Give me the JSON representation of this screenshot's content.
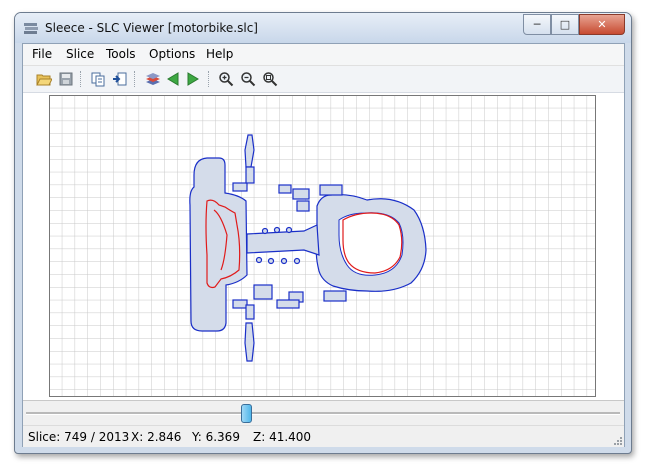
{
  "window": {
    "title": "Sleece - SLC Viewer [motorbike.slc]"
  },
  "caption_buttons": {
    "minimize": "─",
    "maximize": "□",
    "close": "✕"
  },
  "menu": [
    "File",
    "Slice",
    "Tools",
    "Options",
    "Help"
  ],
  "toolbar": {
    "icons": [
      "open-folder-icon",
      "save-icon",
      "copy-icon",
      "import-icon",
      "layers-icon",
      "previous-slice-icon",
      "next-slice-icon",
      "zoom-in-icon",
      "zoom-out-icon",
      "zoom-fit-icon"
    ]
  },
  "colors": {
    "outline": "#1a2fc8",
    "fill": "#d4dcea",
    "inner_contour": "#e01b1b",
    "grid": "#c8c8c8",
    "slider": "#4fb6ea"
  },
  "slider": {
    "position_fraction": 0.37
  },
  "status": {
    "slice": "Slice: 749 / 2013",
    "x": "X: 2.846",
    "y": "Y: 6.369",
    "z": "Z: 41.400"
  }
}
